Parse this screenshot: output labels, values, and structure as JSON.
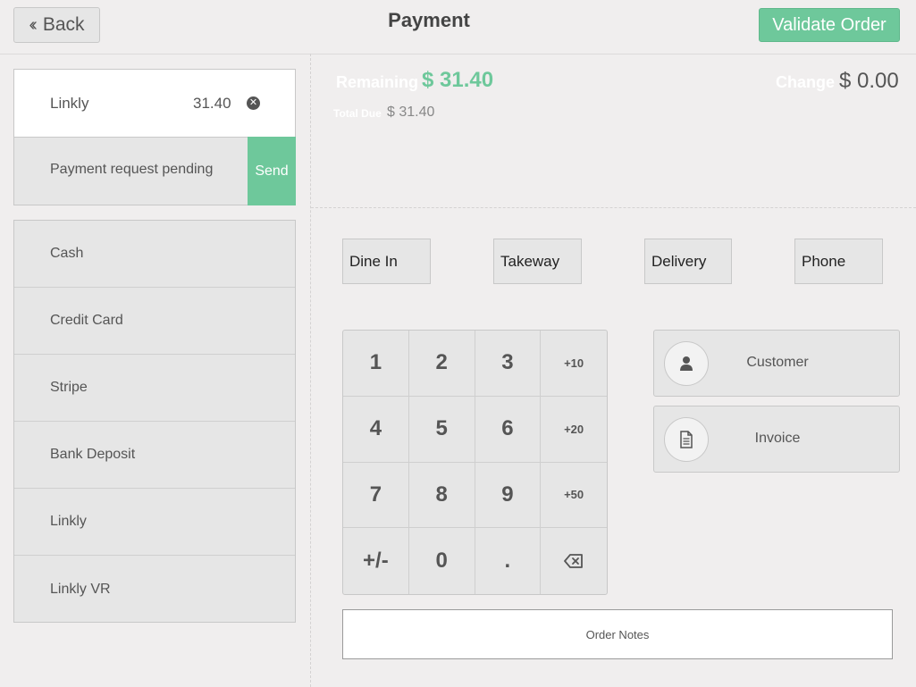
{
  "header": {
    "back_label": "Back",
    "title": "Payment",
    "validate_label": "Validate Order"
  },
  "paymentline": {
    "name": "Linkly",
    "amount": "31.40",
    "pending_text": "Payment request pending",
    "send_label": "Send"
  },
  "methods": [
    "Cash",
    "Credit Card",
    "Stripe",
    "Bank Deposit",
    "Linkly",
    "Linkly VR"
  ],
  "summary": {
    "remaining_label": "Remaining",
    "remaining_value": "$ 31.40",
    "change_label": "Change",
    "change_value": "$ 0.00",
    "total_due_label": "Total Due",
    "total_due_value": "$ 31.40"
  },
  "order_types": [
    "Dine In",
    "Takeway",
    "Delivery",
    "Phone"
  ],
  "numpad": {
    "keys": [
      "1",
      "2",
      "3",
      "+10",
      "4",
      "5",
      "6",
      "+20",
      "7",
      "8",
      "9",
      "+50",
      "+/-",
      "0",
      ".",
      "backspace"
    ]
  },
  "actions": {
    "customer_label": "Customer",
    "invoice_label": "Invoice"
  },
  "notes": {
    "label": "Order Notes"
  },
  "colors": {
    "accent": "#6ec89b",
    "background": "#f0eeee",
    "button": "#e6e6e6"
  }
}
